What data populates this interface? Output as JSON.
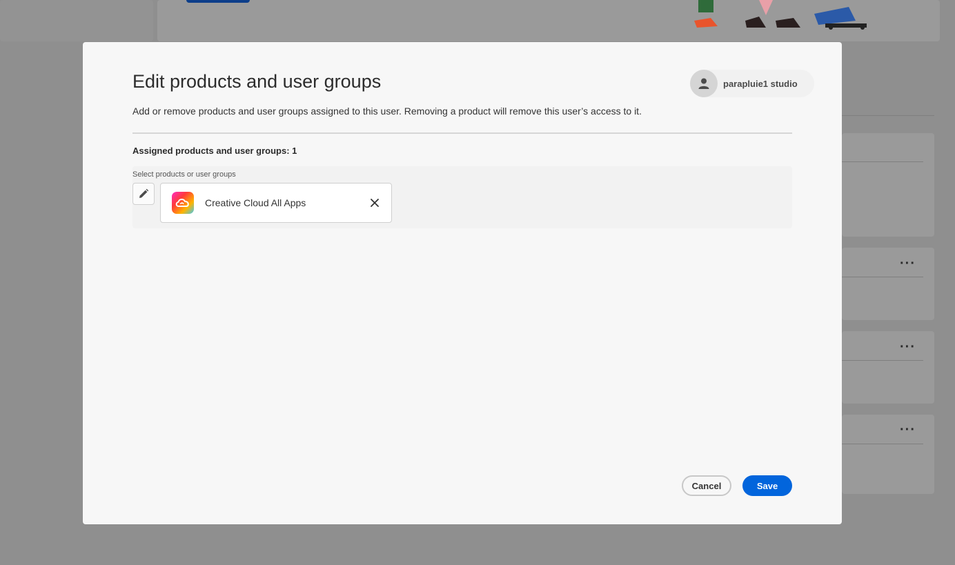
{
  "modal": {
    "title": "Edit products and user groups",
    "description": "Add or remove products and user groups assigned to this user. Removing a product will remove this user’s access to it.",
    "user": {
      "name": "parapluie1 studio",
      "icon": "user-icon"
    },
    "assigned_label": "Assigned products and user groups: 1",
    "select_label": "Select products or user groups",
    "edit_icon": "pencil-icon",
    "products": [
      {
        "name": "Creative Cloud All Apps",
        "icon": "creative-cloud-icon",
        "remove_icon": "close-icon"
      }
    ],
    "buttons": {
      "cancel": "Cancel",
      "save": "Save"
    }
  },
  "colors": {
    "accent": "#0265dc",
    "overlay": "#8f8f8f",
    "modal_bg": "#f7f7f7"
  },
  "background": {
    "menu_icon": "more-icon"
  }
}
